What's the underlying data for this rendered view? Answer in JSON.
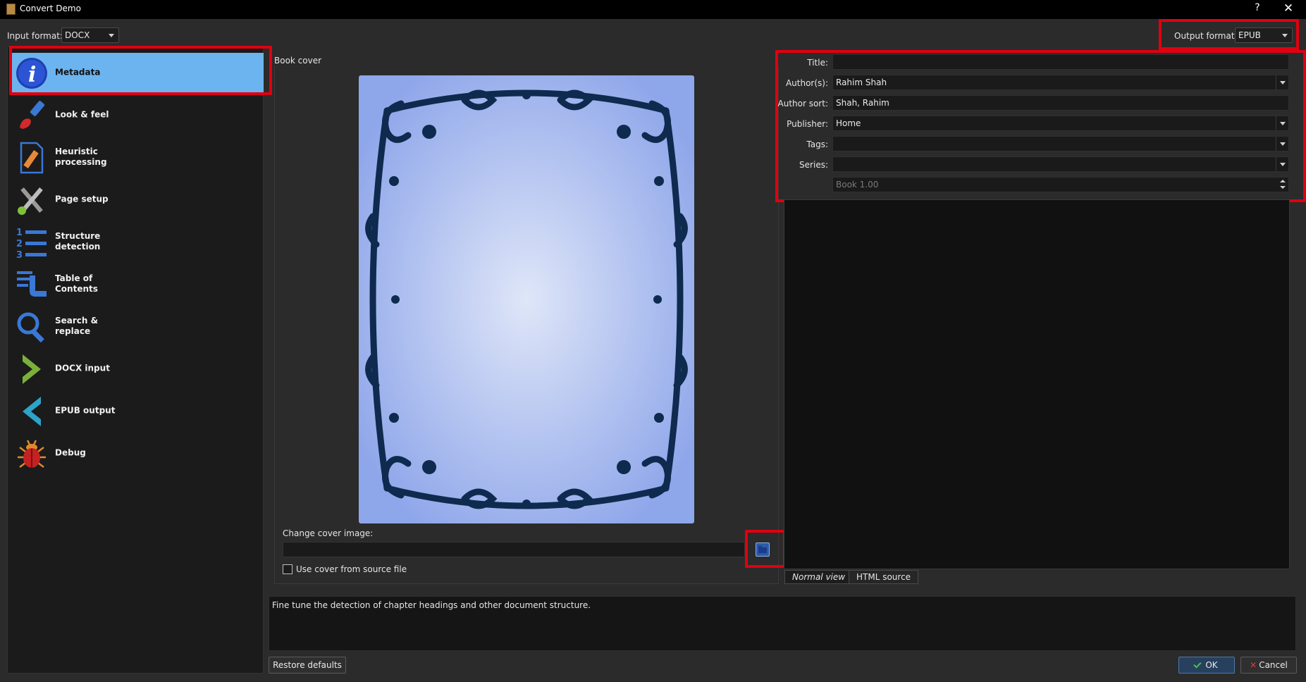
{
  "window": {
    "title": "Convert Demo",
    "help": "?",
    "close": "✕"
  },
  "input_format": {
    "label": "Input format:",
    "value": "DOCX"
  },
  "output_format": {
    "label": "Output format:",
    "value": "EPUB"
  },
  "sidebar": {
    "items": [
      {
        "label": "Metadata",
        "icon": "info-icon",
        "selected": true
      },
      {
        "label": "Look & feel",
        "icon": "paintbrush-icon"
      },
      {
        "label": "Heuristic processing",
        "icon": "document-pencil-icon"
      },
      {
        "label": "Page setup",
        "icon": "tools-icon"
      },
      {
        "label": "Structure detection",
        "icon": "numbered-list-icon"
      },
      {
        "label": "Table of Contents",
        "icon": "toc-icon"
      },
      {
        "label": "Search & replace",
        "icon": "magnifier-icon"
      },
      {
        "label": "DOCX input",
        "icon": "chevron-right-icon"
      },
      {
        "label": "EPUB output",
        "icon": "chevron-left-icon"
      },
      {
        "label": "Debug",
        "icon": "bug-icon"
      }
    ]
  },
  "cover": {
    "section_label": "Book cover",
    "change_label": "Change cover image:",
    "path_value": "",
    "use_source_label": "Use cover from source file",
    "use_source_checked": false
  },
  "metadata": {
    "title_label": "Title:",
    "title_value": "",
    "authors_label": "Author(s):",
    "authors_value": "Rahim Shah",
    "author_sort_label": "Author sort:",
    "author_sort_value": "Shah, Rahim",
    "publisher_label": "Publisher:",
    "publisher_value": "Home",
    "tags_label": "Tags:",
    "tags_value": "",
    "series_label": "Series:",
    "series_value": "",
    "series_index": "Book 1.00"
  },
  "tabs": {
    "normal": "Normal view",
    "html": "HTML source"
  },
  "description": "Fine tune the detection of chapter headings and other document structure.",
  "buttons": {
    "restore": "Restore defaults",
    "ok": "OK",
    "cancel": "Cancel"
  }
}
